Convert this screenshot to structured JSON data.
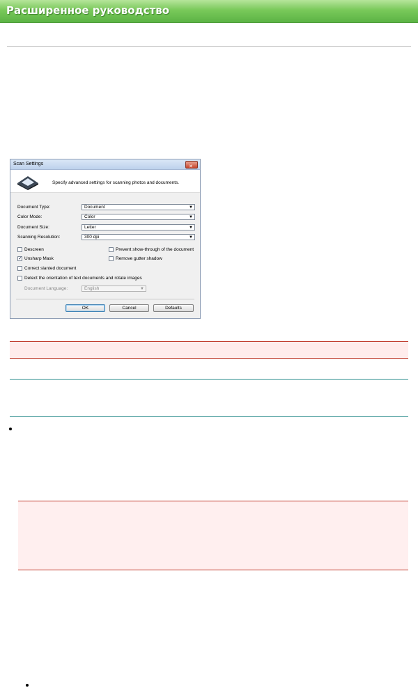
{
  "banner": {
    "title": "Расширенное руководство"
  },
  "dialog": {
    "title": "Scan Settings",
    "close_glyph": "✕",
    "description": "Specify advanced settings for scanning photos and documents.",
    "fields": [
      {
        "label": "Document Type:",
        "value": "Document"
      },
      {
        "label": "Color Mode:",
        "value": "Color"
      },
      {
        "label": "Document Size:",
        "value": "Letter"
      },
      {
        "label": "Scanning Resolution:",
        "value": "300 dpi"
      }
    ],
    "checkboxes": {
      "descreen": {
        "label": "Descreen",
        "checked": false
      },
      "prevent_show_through": {
        "label": "Prevent show-through of the document",
        "checked": false
      },
      "unsharp_mask": {
        "label": "Unsharp Mask",
        "checked": true
      },
      "remove_gutter_shadow": {
        "label": "Remove gutter shadow",
        "checked": false
      },
      "correct_slanted": {
        "label": "Correct slanted document",
        "checked": false
      },
      "detect_orientation": {
        "label": "Detect the orientation of text documents and rotate images",
        "checked": false
      }
    },
    "language": {
      "label": "Document Language:",
      "value": "English"
    },
    "buttons": {
      "ok": "OK",
      "cancel": "Cancel",
      "defaults": "Defaults"
    }
  },
  "colors": {
    "banner_green": "#79c95a",
    "rule_red": "#c0392b",
    "rule_teal": "#2f8f8f",
    "note_pink": "#ffecec"
  }
}
